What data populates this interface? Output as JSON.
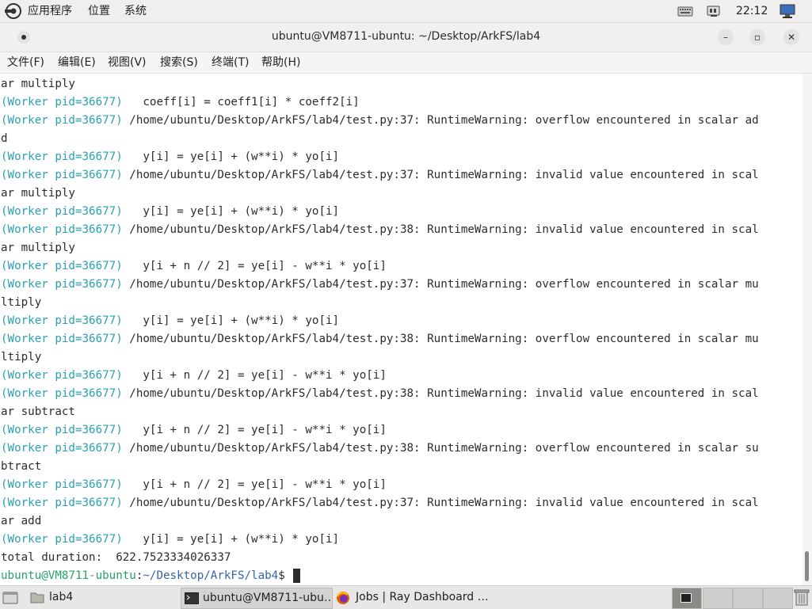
{
  "top_panel": {
    "menus": [
      "应用程序",
      "位置",
      "系统"
    ],
    "clock": "22:12",
    "tray_icons": [
      "keyboard-icon",
      "network-icon",
      "display-icon"
    ]
  },
  "window": {
    "title": "ubuntu@VM8711-ubuntu: ~/Desktop/ArkFS/lab4",
    "controls": [
      "minimize",
      "maximize",
      "close"
    ]
  },
  "menubar": {
    "items": [
      "文件(F)",
      "编辑(E)",
      "视图(V)",
      "搜索(S)",
      "终端(T)",
      "帮助(H)"
    ]
  },
  "terminal": {
    "lines": [
      {
        "pre": "",
        "text": "ar multiply"
      },
      {
        "pre": "(Worker pid=36677)",
        "text": "   coeff[i] = coeff1[i] * coeff2[i]"
      },
      {
        "pre": "(Worker pid=36677)",
        "text": " /home/ubuntu/Desktop/ArkFS/lab4/test.py:37: RuntimeWarning: overflow encountered in scalar ad"
      },
      {
        "pre": "",
        "text": "d"
      },
      {
        "pre": "(Worker pid=36677)",
        "text": "   y[i] = ye[i] + (w**i) * yo[i]"
      },
      {
        "pre": "(Worker pid=36677)",
        "text": " /home/ubuntu/Desktop/ArkFS/lab4/test.py:37: RuntimeWarning: invalid value encountered in scal"
      },
      {
        "pre": "",
        "text": "ar multiply"
      },
      {
        "pre": "(Worker pid=36677)",
        "text": "   y[i] = ye[i] + (w**i) * yo[i]"
      },
      {
        "pre": "(Worker pid=36677)",
        "text": " /home/ubuntu/Desktop/ArkFS/lab4/test.py:38: RuntimeWarning: invalid value encountered in scal"
      },
      {
        "pre": "",
        "text": "ar multiply"
      },
      {
        "pre": "(Worker pid=36677)",
        "text": "   y[i + n // 2] = ye[i] - w**i * yo[i]"
      },
      {
        "pre": "(Worker pid=36677)",
        "text": " /home/ubuntu/Desktop/ArkFS/lab4/test.py:37: RuntimeWarning: overflow encountered in scalar mu"
      },
      {
        "pre": "",
        "text": "ltiply"
      },
      {
        "pre": "(Worker pid=36677)",
        "text": "   y[i] = ye[i] + (w**i) * yo[i]"
      },
      {
        "pre": "(Worker pid=36677)",
        "text": " /home/ubuntu/Desktop/ArkFS/lab4/test.py:38: RuntimeWarning: overflow encountered in scalar mu"
      },
      {
        "pre": "",
        "text": "ltiply"
      },
      {
        "pre": "(Worker pid=36677)",
        "text": "   y[i + n // 2] = ye[i] - w**i * yo[i]"
      },
      {
        "pre": "(Worker pid=36677)",
        "text": " /home/ubuntu/Desktop/ArkFS/lab4/test.py:38: RuntimeWarning: invalid value encountered in scal"
      },
      {
        "pre": "",
        "text": "ar subtract"
      },
      {
        "pre": "(Worker pid=36677)",
        "text": "   y[i + n // 2] = ye[i] - w**i * yo[i]"
      },
      {
        "pre": "(Worker pid=36677)",
        "text": " /home/ubuntu/Desktop/ArkFS/lab4/test.py:38: RuntimeWarning: overflow encountered in scalar su"
      },
      {
        "pre": "",
        "text": "btract"
      },
      {
        "pre": "(Worker pid=36677)",
        "text": "   y[i + n // 2] = ye[i] - w**i * yo[i]"
      },
      {
        "pre": "(Worker pid=36677)",
        "text": " /home/ubuntu/Desktop/ArkFS/lab4/test.py:37: RuntimeWarning: invalid value encountered in scal"
      },
      {
        "pre": "",
        "text": "ar add"
      },
      {
        "pre": "(Worker pid=36677)",
        "text": "   y[i] = ye[i] + (w**i) * yo[i]"
      },
      {
        "pre": "",
        "text": "total duration:  622.7523334026337"
      }
    ],
    "prompt": {
      "user_host": "ubuntu@VM8711-ubuntu",
      "sep": ":",
      "path": "~/Desktop/ArkFS/lab4",
      "symbol": "$ "
    },
    "colors": {
      "worker": "#2aa1b3",
      "prompt_user": "#26a269",
      "prompt_path": "#3465a4"
    }
  },
  "taskbar": {
    "show_desktop_icon": "desktop-icon",
    "tasks": [
      {
        "label": "lab4",
        "icon": "folder-icon",
        "active": false
      },
      {
        "label": "ubuntu@VM8711-ubu…",
        "icon": "terminal-icon",
        "active": true
      },
      {
        "label": "Jobs | Ray Dashboard …",
        "icon": "firefox-icon",
        "active": false
      }
    ],
    "workspaces": [
      true,
      false,
      false,
      false
    ],
    "trash_icon": "trash-icon"
  }
}
